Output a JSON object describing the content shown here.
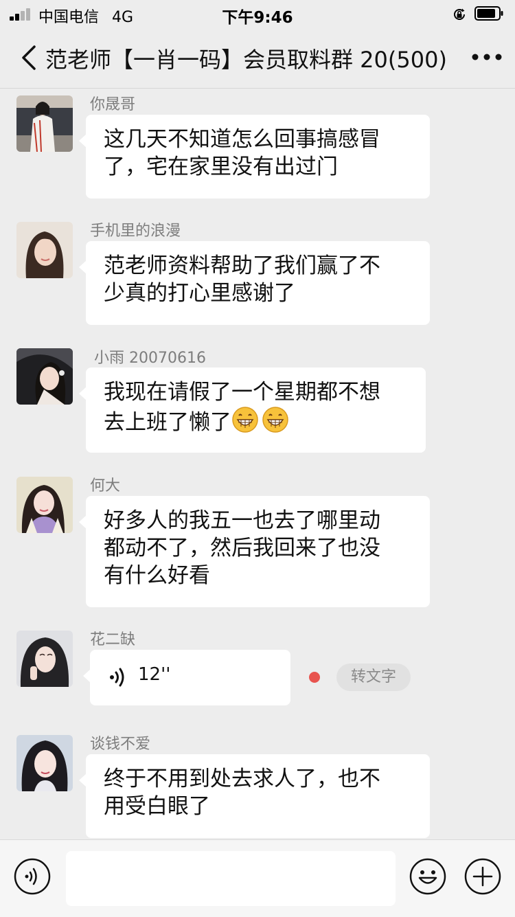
{
  "status_bar": {
    "carrier": "中国电信",
    "network": "4G",
    "time": "下午9:46"
  },
  "header": {
    "title": "范老师【一肖一码】会员取料群 20(500)"
  },
  "messages": [
    {
      "sender": "你晟哥",
      "lines": [
        "这几天不知道怎么回事搞感冒",
        "了，宅在家里没有出过门"
      ]
    },
    {
      "sender": "手机里的浪漫",
      "lines": [
        "范老师资料帮助了我们赢了不",
        "少真的打心里感谢了"
      ]
    },
    {
      "sender": "小雨 20070616",
      "lines": [
        "我现在请假了一个星期都不想",
        "去上班了懒了"
      ],
      "emoji": "grinning-face",
      "emoji_count": 2
    },
    {
      "sender": "何大",
      "lines": [
        "好多人的我五一也去了哪里动",
        "都动不了，然后我回来了也没",
        "有什么好看"
      ]
    },
    {
      "sender": "花二缺",
      "voice_duration": "12''",
      "transcribe_label": "转文字",
      "unread": true
    },
    {
      "sender": "谈钱不爱",
      "lines": [
        "终于不用到处去求人了，也不",
        "用受白眼了"
      ]
    }
  ],
  "input_bar": {
    "placeholder": ""
  },
  "colors": {
    "background": "#ededed",
    "bubble": "#ffffff",
    "sender_name": "#7d7d7d",
    "unread_dot": "#e8544f"
  }
}
